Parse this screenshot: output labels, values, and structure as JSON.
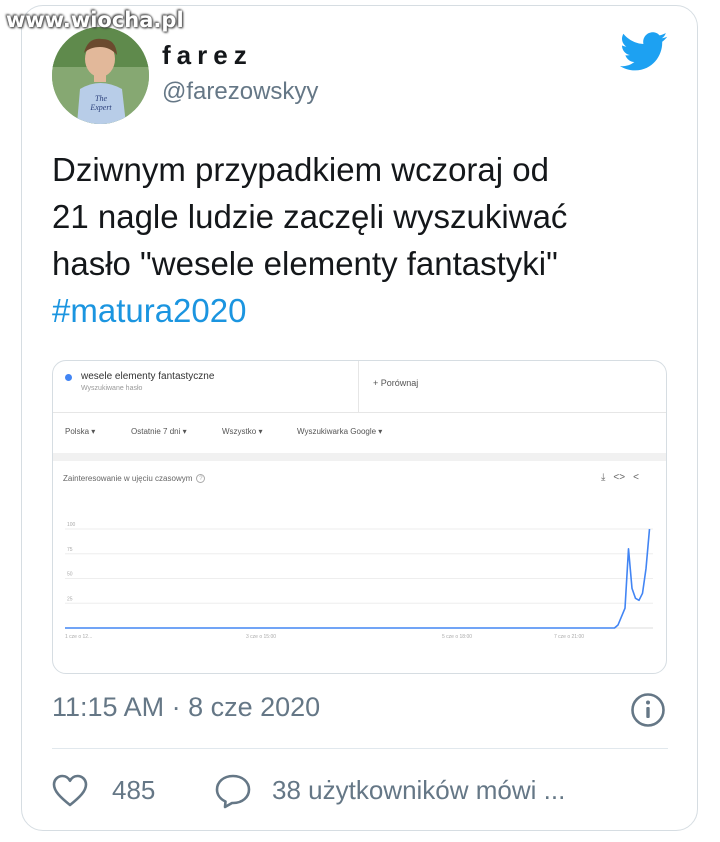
{
  "watermark": "www.wiocha.pl",
  "user": {
    "display_name": "farez",
    "handle": "@farezowskyy",
    "avatar_shirt_text": "The Expert"
  },
  "tweet": {
    "lines": [
      "Dziwnym przypadkiem wczoraj od",
      "21 nagle ludzie zaczęli wyszukiwać",
      "hasło \"wesele elementy fantastyki\""
    ],
    "hashtag": "#matura2020"
  },
  "trends": {
    "search_term": "wesele elementy fantastyczne",
    "search_term_sub": "Wyszukiwane hasło",
    "compare": "+ Porównaj",
    "filters": [
      "Polska",
      "Ostatnie 7 dni",
      "Wszystko",
      "Wyszukiwarka Google"
    ],
    "chart_title": "Zainteresowanie w ujęciu czasowym",
    "icons": [
      "download-icon",
      "embed-icon",
      "share-icon"
    ]
  },
  "chart_data": {
    "type": "line",
    "title": "Zainteresowanie w ujęciu czasowym",
    "xlabel": "",
    "ylabel": "",
    "ylim": [
      0,
      100
    ],
    "yticks": [
      25,
      50,
      75,
      100
    ],
    "grid": true,
    "x_tick_labels": [
      "1 cze o 12...",
      "3 cze o 15:00",
      "5 cze o 18:00",
      "7 cze o 21:00"
    ],
    "series": [
      {
        "color": "#4285f4",
        "x": [
          0,
          150,
          157,
          158,
          160,
          161,
          162,
          163,
          164,
          165,
          166,
          167
        ],
        "values": [
          0,
          0,
          0,
          3,
          20,
          80,
          40,
          30,
          28,
          35,
          60,
          100
        ]
      }
    ]
  },
  "footer": {
    "timestamp": "11:15 AM · 8 cze 2020",
    "likes": "485",
    "replies": "38 użytkowników mówi ..."
  },
  "colors": {
    "accent": "#1b95e0",
    "twitter_blue": "#1da1f2",
    "muted": "#657786",
    "trend_line": "#4285f4"
  }
}
